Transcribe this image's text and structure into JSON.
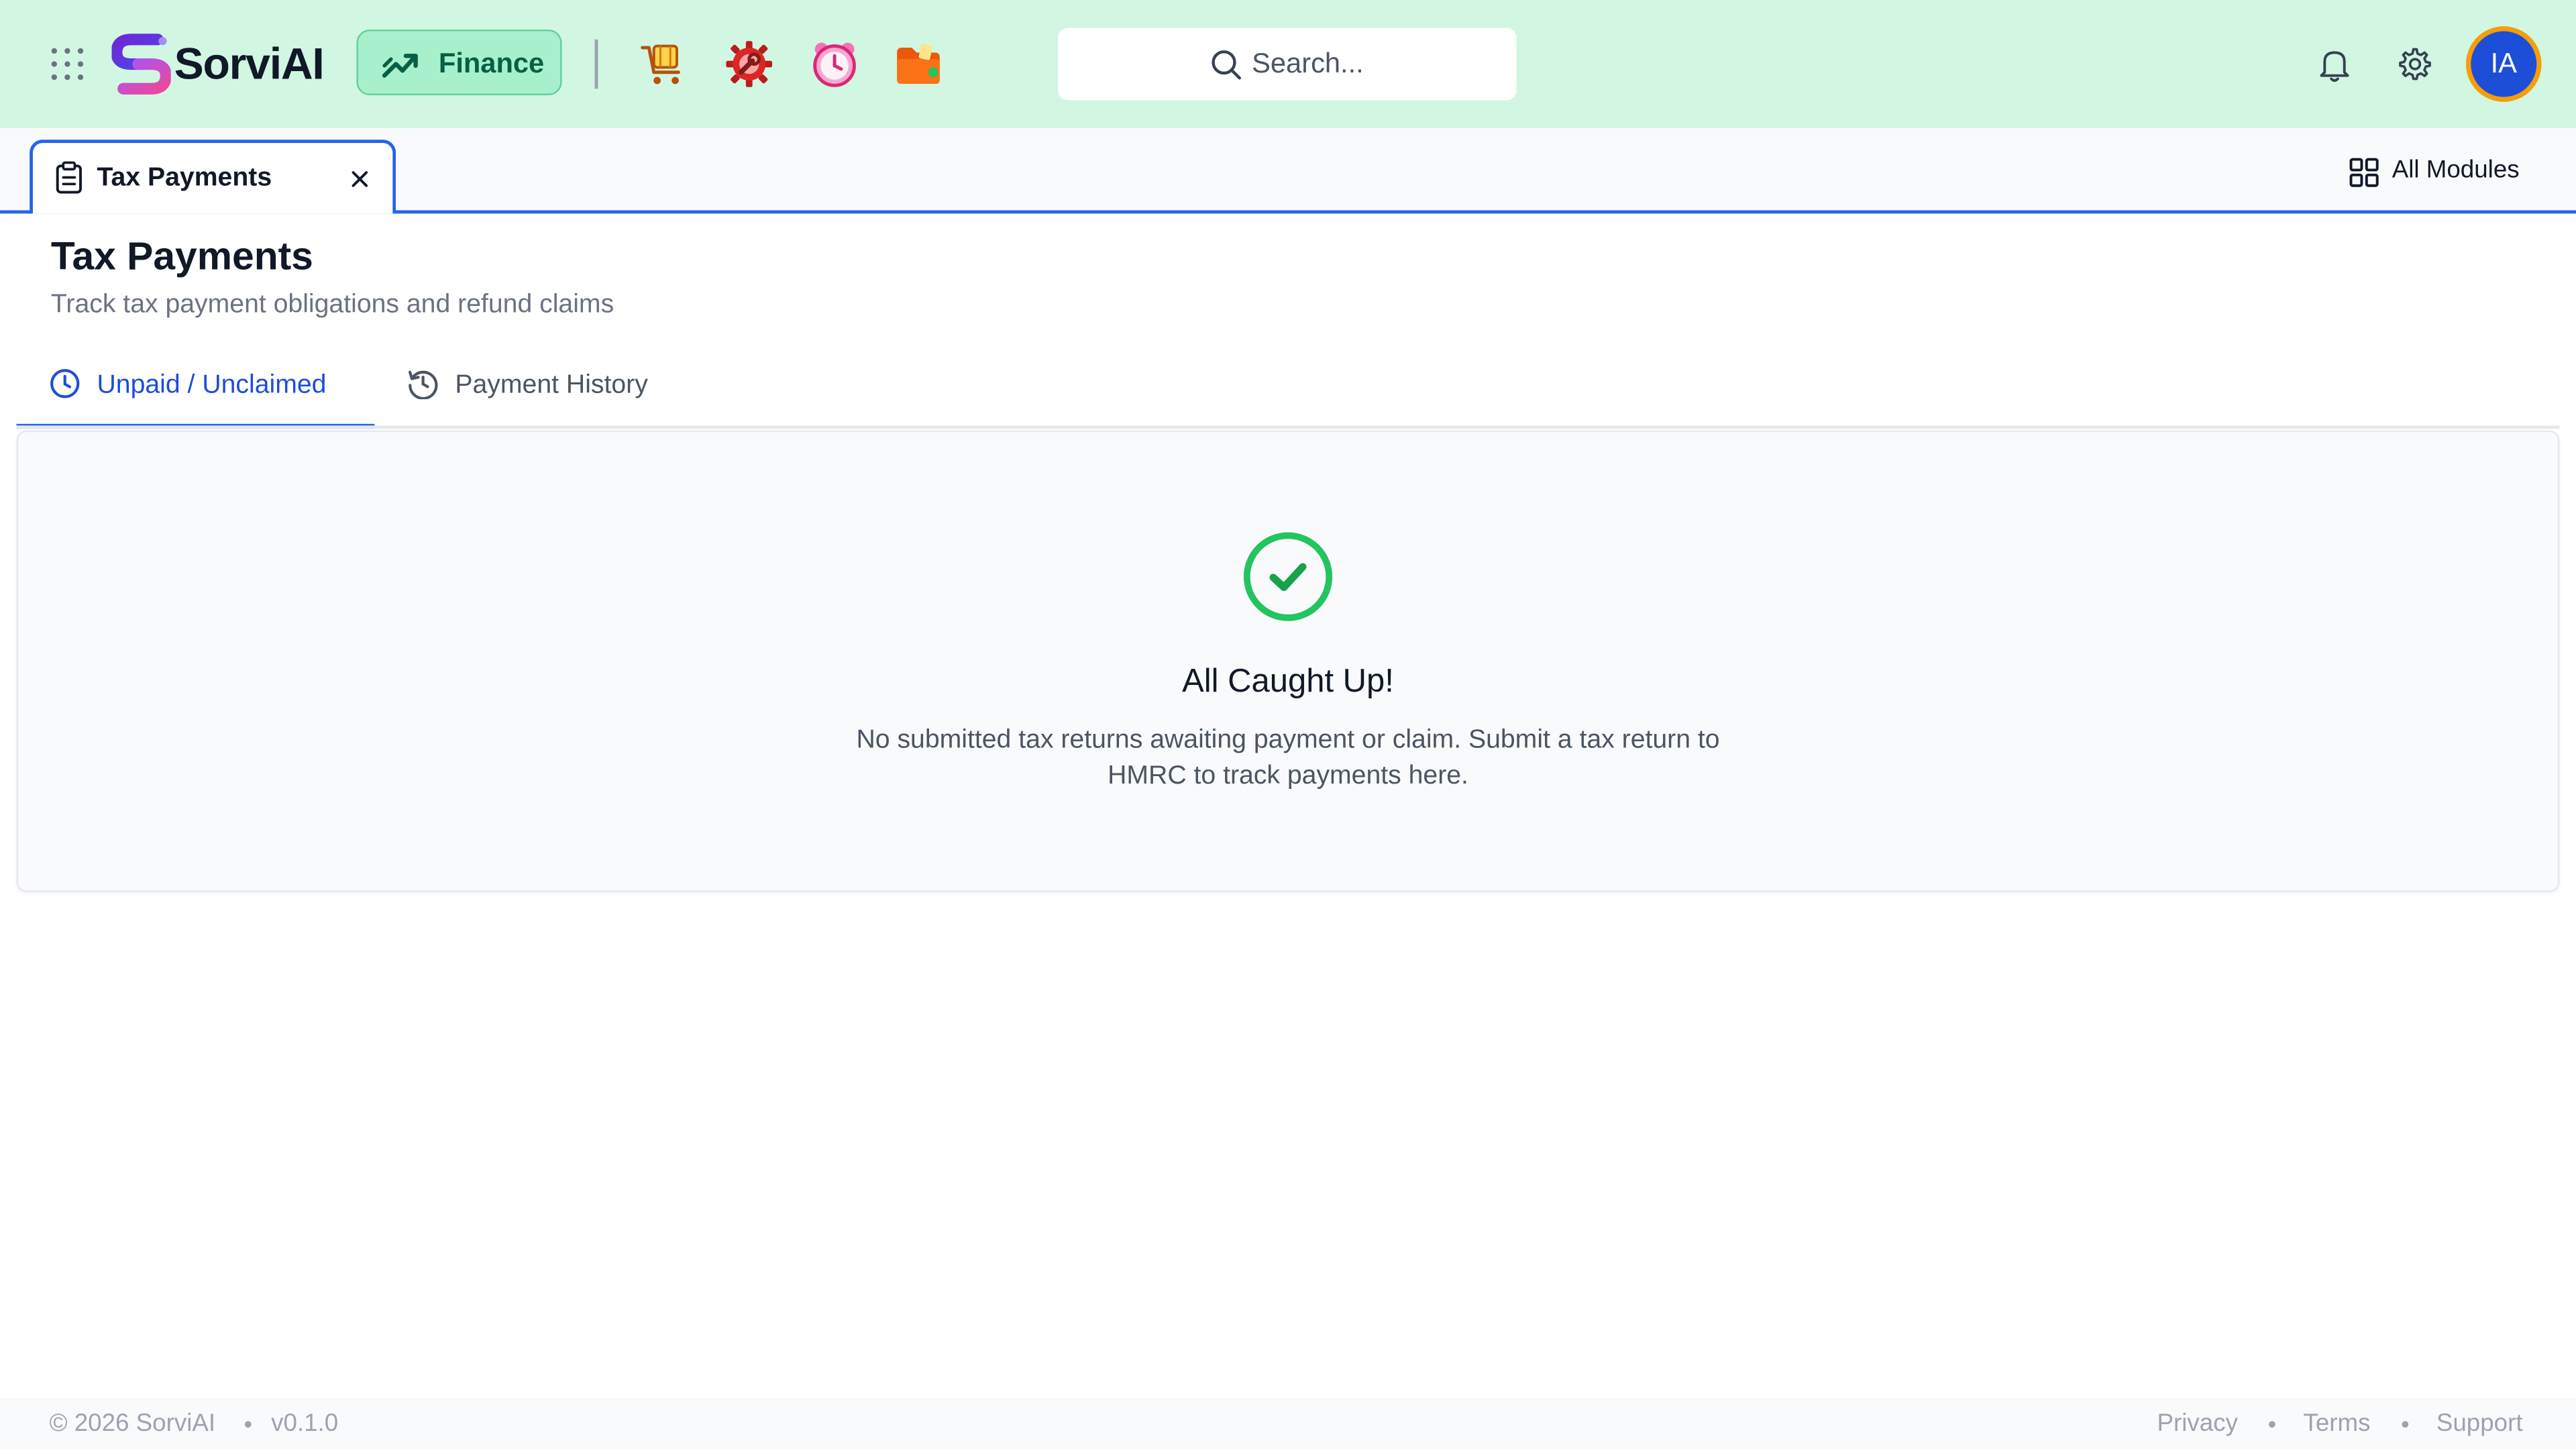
{
  "header": {
    "brand": "SorviAI",
    "module_label": "Finance",
    "search_placeholder": "Search...",
    "avatar_initials": "IA",
    "app_icons": [
      "shopping-cart-icon",
      "gear-wrench-icon",
      "alarm-clock-icon",
      "folder-icon"
    ]
  },
  "tabbar": {
    "open_tab_label": "Tax Payments",
    "all_modules_label": "All Modules"
  },
  "page": {
    "title": "Tax Payments",
    "subtitle": "Track tax payment obligations and refund claims",
    "tabs": [
      {
        "label": "Unpaid / Unclaimed",
        "active": true
      },
      {
        "label": "Payment History",
        "active": false
      }
    ]
  },
  "empty_state": {
    "title": "All Caught Up!",
    "description": "No submitted tax returns awaiting payment or claim. Submit a tax return to HMRC to track payments here."
  },
  "footer": {
    "copyright": "© 2026 SorviAI",
    "version": "v0.1.0",
    "links": [
      "Privacy",
      "Terms",
      "Support"
    ]
  },
  "colors": {
    "header_bg": "#d1f7e3",
    "accent": "#2563eb",
    "success": "#22c55e",
    "module_bg": "#a7f0cb",
    "avatar_ring": "#f59e0b"
  }
}
